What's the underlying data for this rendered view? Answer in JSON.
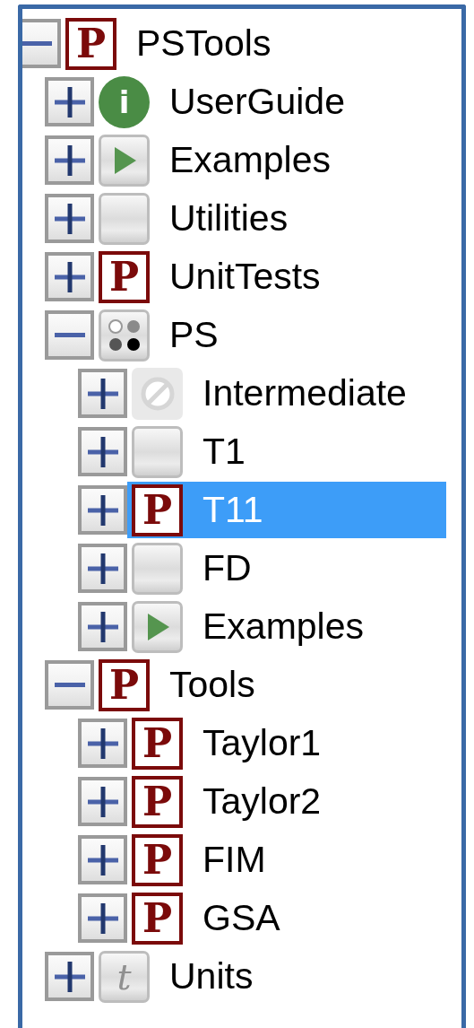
{
  "tree": [
    {
      "label": "PSTools",
      "expanded": true,
      "selected": false,
      "icon": {
        "kind": "p",
        "glyph": "P"
      },
      "children": [
        {
          "label": "UserGuide",
          "expanded": false,
          "selected": false,
          "icon": {
            "kind": "info",
            "glyph": "i"
          }
        },
        {
          "label": "Examples",
          "expanded": false,
          "selected": false,
          "icon": {
            "kind": "play"
          }
        },
        {
          "label": "Utilities",
          "expanded": false,
          "selected": false,
          "icon": {
            "kind": "blank"
          }
        },
        {
          "label": "UnitTests",
          "expanded": false,
          "selected": false,
          "icon": {
            "kind": "p",
            "glyph": "P"
          }
        },
        {
          "label": "PS",
          "expanded": true,
          "selected": false,
          "icon": {
            "kind": "dots"
          },
          "children": [
            {
              "label": "Intermediate",
              "expanded": false,
              "selected": false,
              "icon": {
                "kind": "disabled"
              }
            },
            {
              "label": "T1",
              "expanded": false,
              "selected": false,
              "icon": {
                "kind": "blank"
              }
            },
            {
              "label": "T11",
              "expanded": false,
              "selected": true,
              "icon": {
                "kind": "p",
                "glyph": "P"
              }
            },
            {
              "label": "FD",
              "expanded": false,
              "selected": false,
              "icon": {
                "kind": "blank"
              }
            },
            {
              "label": "Examples",
              "expanded": false,
              "selected": false,
              "icon": {
                "kind": "play"
              }
            }
          ]
        },
        {
          "label": "Tools",
          "expanded": true,
          "selected": false,
          "icon": {
            "kind": "p",
            "glyph": "P"
          },
          "children": [
            {
              "label": "Taylor1",
              "expanded": false,
              "selected": false,
              "icon": {
                "kind": "p",
                "glyph": "P"
              }
            },
            {
              "label": "Taylor2",
              "expanded": false,
              "selected": false,
              "icon": {
                "kind": "p",
                "glyph": "P"
              }
            },
            {
              "label": "FIM",
              "expanded": false,
              "selected": false,
              "icon": {
                "kind": "p",
                "glyph": "P"
              }
            },
            {
              "label": "GSA",
              "expanded": false,
              "selected": false,
              "icon": {
                "kind": "p",
                "glyph": "P"
              }
            }
          ]
        },
        {
          "label": "Units",
          "expanded": false,
          "selected": false,
          "icon": {
            "kind": "t",
            "glyph": "t"
          }
        }
      ]
    }
  ]
}
